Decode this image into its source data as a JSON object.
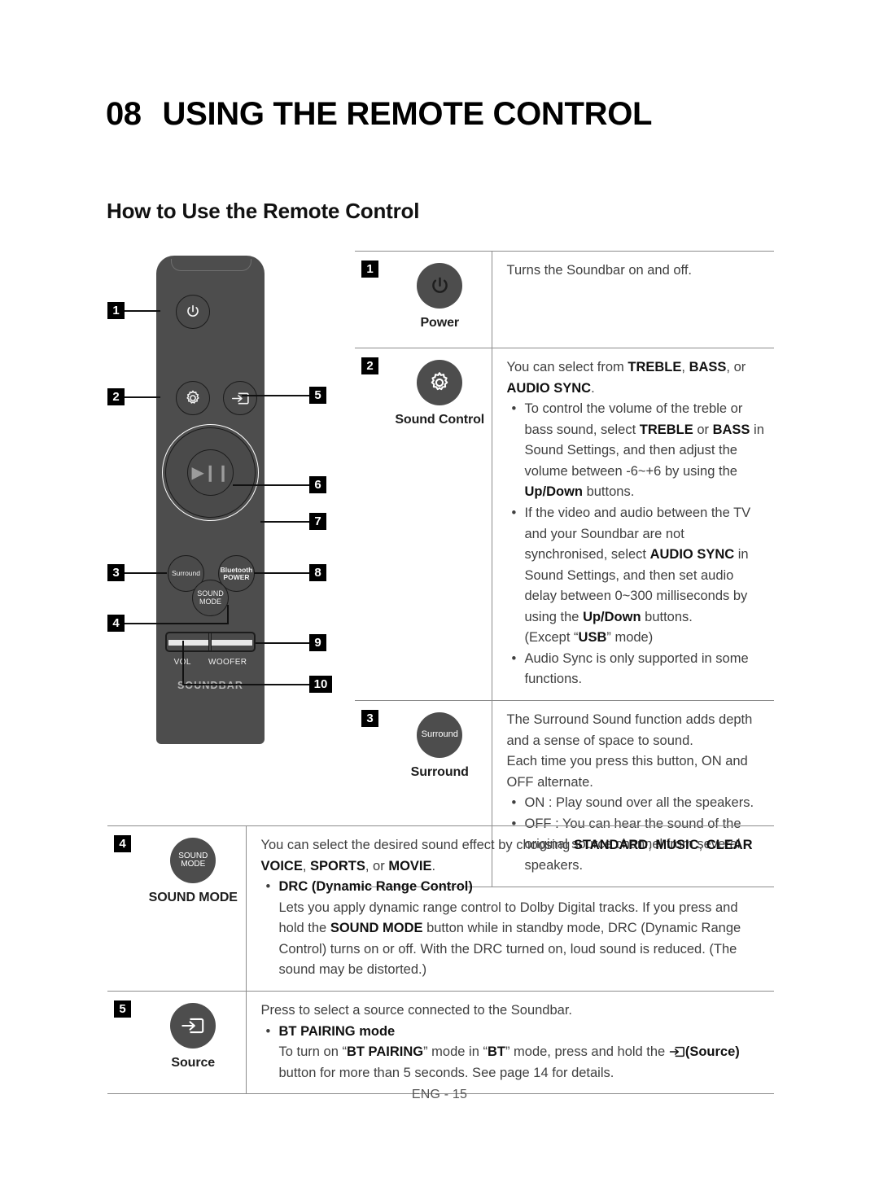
{
  "header": {
    "chapter_number": "08",
    "chapter_title": "USING THE REMOTE CONTROL",
    "section_title": "How to Use the Remote Control"
  },
  "remote": {
    "brand": "SOUNDBAR",
    "buttons": {
      "power": "power-icon",
      "settings": "gear-icon",
      "source": "source-icon",
      "play_pause": "▶❙❙",
      "surround": "Surround",
      "bluetooth_line1": "Bluetooth",
      "bluetooth_line2": "POWER",
      "sound_mode_line1": "SOUND",
      "sound_mode_line2": "MODE",
      "vol": "VOL",
      "woofer": "WOOFER"
    },
    "callouts": [
      {
        "num": "1"
      },
      {
        "num": "2"
      },
      {
        "num": "3"
      },
      {
        "num": "4"
      },
      {
        "num": "5"
      },
      {
        "num": "6"
      },
      {
        "num": "7"
      },
      {
        "num": "8"
      },
      {
        "num": "9"
      },
      {
        "num": "10"
      }
    ]
  },
  "table_top": {
    "rows": [
      {
        "badge": "1",
        "icon_label": "Power",
        "icon_glyph": "power-icon",
        "text_intro": "Turns the Soundbar on and off."
      },
      {
        "badge": "2",
        "icon_label": "Sound Control",
        "icon_glyph": "gear-icon",
        "text_intro_a": "You can select from ",
        "text_intro_b": "TREBLE",
        "text_intro_c": ", ",
        "text_intro_d": "BASS",
        "text_intro_e": ", or ",
        "text_intro_f": "AUDIO SYNC",
        "text_intro_g": ".",
        "bullets": [
          "To control the volume of the treble or bass sound, select TREBLE or BASS in Sound Settings, and then adjust the volume between -6~+6 by using the Up/Down buttons.",
          "If the video and audio between the TV and your Soundbar are not synchronised, select AUDIO SYNC in Sound Settings, and then set audio delay between 0~300 milliseconds by using the Up/Down buttons. (Except “USB” mode)",
          "Audio Sync is only supported in some functions."
        ]
      },
      {
        "badge": "3",
        "icon_label": "Surround",
        "icon_glyph": "Surround",
        "text_intro": "The Surround Sound function adds depth and a sense of space to sound.",
        "text_intro2": "Each time you press this button, ON and OFF alternate.",
        "bullets": [
          "ON : Play sound over all the speakers.",
          "OFF : You can hear the sound of the original source channel from several speakers."
        ]
      }
    ]
  },
  "table_bottom": {
    "rows": [
      {
        "badge": "4",
        "icon_label": "SOUND MODE",
        "icon_line1": "SOUND",
        "icon_line2": "MODE",
        "intro_a": "You can select the desired sound effect by choosing ",
        "intro_opt1": "STANDARD",
        "intro_opt2": "MUSIC",
        "intro_opt3": "CLEAR VOICE",
        "intro_opt4": "SPORTS",
        "intro_or": ", or ",
        "intro_opt5": "MOVIE",
        "bullet_title": "DRC (Dynamic Range Control)",
        "bullet_body_a": "Lets you apply dynamic range control to Dolby Digital tracks. If you press and hold the ",
        "bullet_body_b": "SOUND MODE",
        "bullet_body_c": " button while in standby mode, DRC (Dynamic Range Control) turns on or off. With the DRC turned on, loud sound is reduced. (The sound may be distorted.)"
      },
      {
        "badge": "5",
        "icon_label": "Source",
        "icon_glyph": "source-icon",
        "intro": "Press to select a source connected to the Soundbar.",
        "bullet_title": "BT PAIRING mode",
        "bullet_body_a": "To turn on “",
        "bullet_body_b": "BT PAIRING",
        "bullet_body_c": "” mode in “",
        "bullet_body_d": "BT",
        "bullet_body_e": "” mode, press and hold the ",
        "bullet_body_f": "(Source)",
        "bullet_body_g": " button for more than 5 seconds. See page 14 for details."
      }
    ]
  },
  "footer": {
    "page_label": "ENG - 15"
  },
  "colors": {
    "remote_body": "#4d4d4d",
    "button_face": "#4a4a4a",
    "badge_bg": "#000000",
    "rule": "#8c8c8c"
  }
}
